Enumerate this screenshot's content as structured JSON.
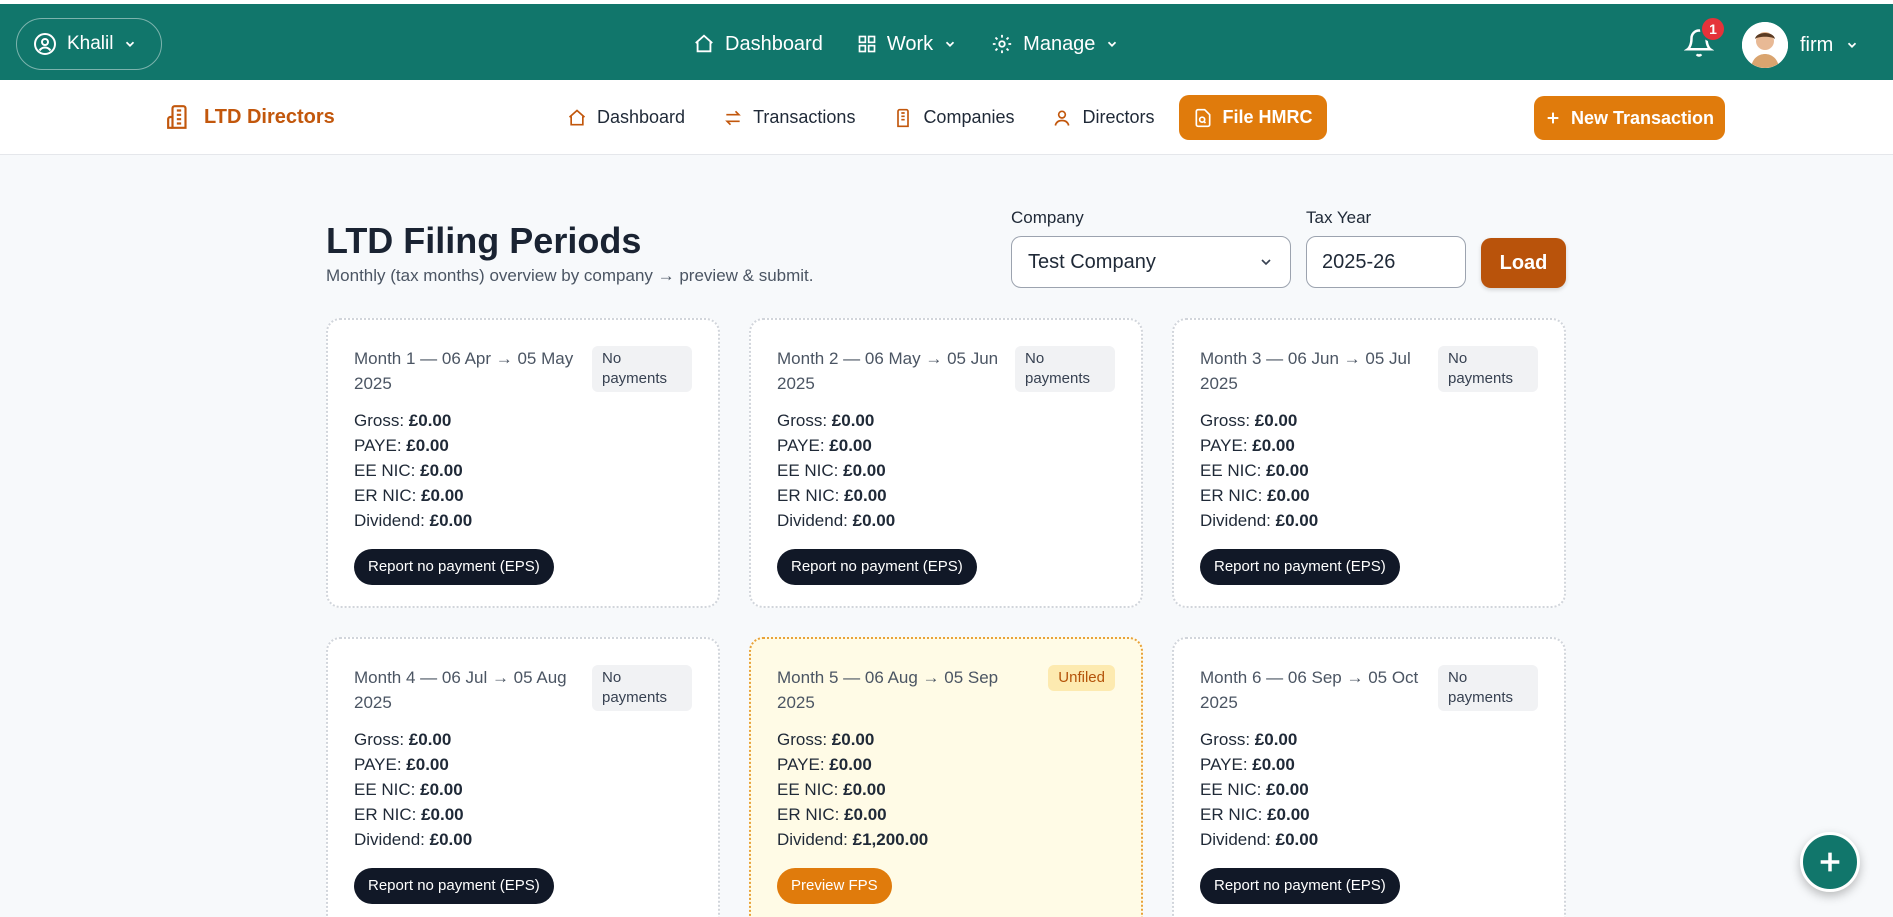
{
  "topbar": {
    "user_name": "Khalil",
    "nav": [
      {
        "label": "Dashboard",
        "icon": "home-icon"
      },
      {
        "label": "Work",
        "icon": "grid-icon"
      },
      {
        "label": "Manage",
        "icon": "gear-icon"
      }
    ],
    "notification_count": "1",
    "profile_name": "firm"
  },
  "subnav": {
    "brand": "LTD Directors",
    "tabs": [
      {
        "label": "Dashboard",
        "icon": "home-icon"
      },
      {
        "label": "Transactions",
        "icon": "swap-icon"
      },
      {
        "label": "Companies",
        "icon": "building-icon"
      },
      {
        "label": "Directors",
        "icon": "person-icon"
      },
      {
        "label": "File HMRC",
        "icon": "file-search-icon",
        "active": true
      }
    ],
    "new_transaction": "New Transaction"
  },
  "page": {
    "title": "LTD Filing Periods",
    "subtitle": "Monthly (tax months) overview by company → preview & submit.",
    "company_label": "Company",
    "company_value": "Test Company",
    "tax_year_label": "Tax Year",
    "tax_year_value": "2025-26",
    "load_label": "Load"
  },
  "labels": {
    "gross": "Gross:",
    "paye": "PAYE:",
    "ee_nic": "EE NIC:",
    "er_nic": "ER NIC:",
    "dividend": "Dividend:"
  },
  "periods": [
    {
      "title": "Month 1 — 06 Apr → 05 May 2025",
      "status": "No payments",
      "gross": "£0.00",
      "paye": "£0.00",
      "ee_nic": "£0.00",
      "er_nic": "£0.00",
      "dividend": "£0.00",
      "action": "Report no payment (EPS)"
    },
    {
      "title": "Month 2 — 06 May → 05 Jun 2025",
      "status": "No payments",
      "gross": "£0.00",
      "paye": "£0.00",
      "ee_nic": "£0.00",
      "er_nic": "£0.00",
      "dividend": "£0.00",
      "action": "Report no payment (EPS)"
    },
    {
      "title": "Month 3 — 06 Jun → 05 Jul 2025",
      "status": "No payments",
      "gross": "£0.00",
      "paye": "£0.00",
      "ee_nic": "£0.00",
      "er_nic": "£0.00",
      "dividend": "£0.00",
      "action": "Report no payment (EPS)"
    },
    {
      "title": "Month 4 — 06 Jul → 05 Aug 2025",
      "status": "No payments",
      "gross": "£0.00",
      "paye": "£0.00",
      "ee_nic": "£0.00",
      "er_nic": "£0.00",
      "dividend": "£0.00",
      "action": "Report no payment (EPS)"
    },
    {
      "title": "Month 5 — 06 Aug → 05 Sep 2025",
      "status": "Unfiled",
      "gross": "£0.00",
      "paye": "£0.00",
      "ee_nic": "£0.00",
      "er_nic": "£0.00",
      "dividend": "£1,200.00",
      "action": "Preview FPS"
    },
    {
      "title": "Month 6 — 06 Sep → 05 Oct 2025",
      "status": "No payments",
      "gross": "£0.00",
      "paye": "£0.00",
      "ee_nic": "£0.00",
      "er_nic": "£0.00",
      "dividend": "£0.00",
      "action": "Report no payment (EPS)"
    }
  ],
  "colors": {
    "topbar": "#11766b",
    "accent": "#e07b0c",
    "brand": "#c2570c",
    "load": "#b9530b",
    "unfiled_bg": "#fffbe6",
    "badge_alert": "#e5333a"
  }
}
